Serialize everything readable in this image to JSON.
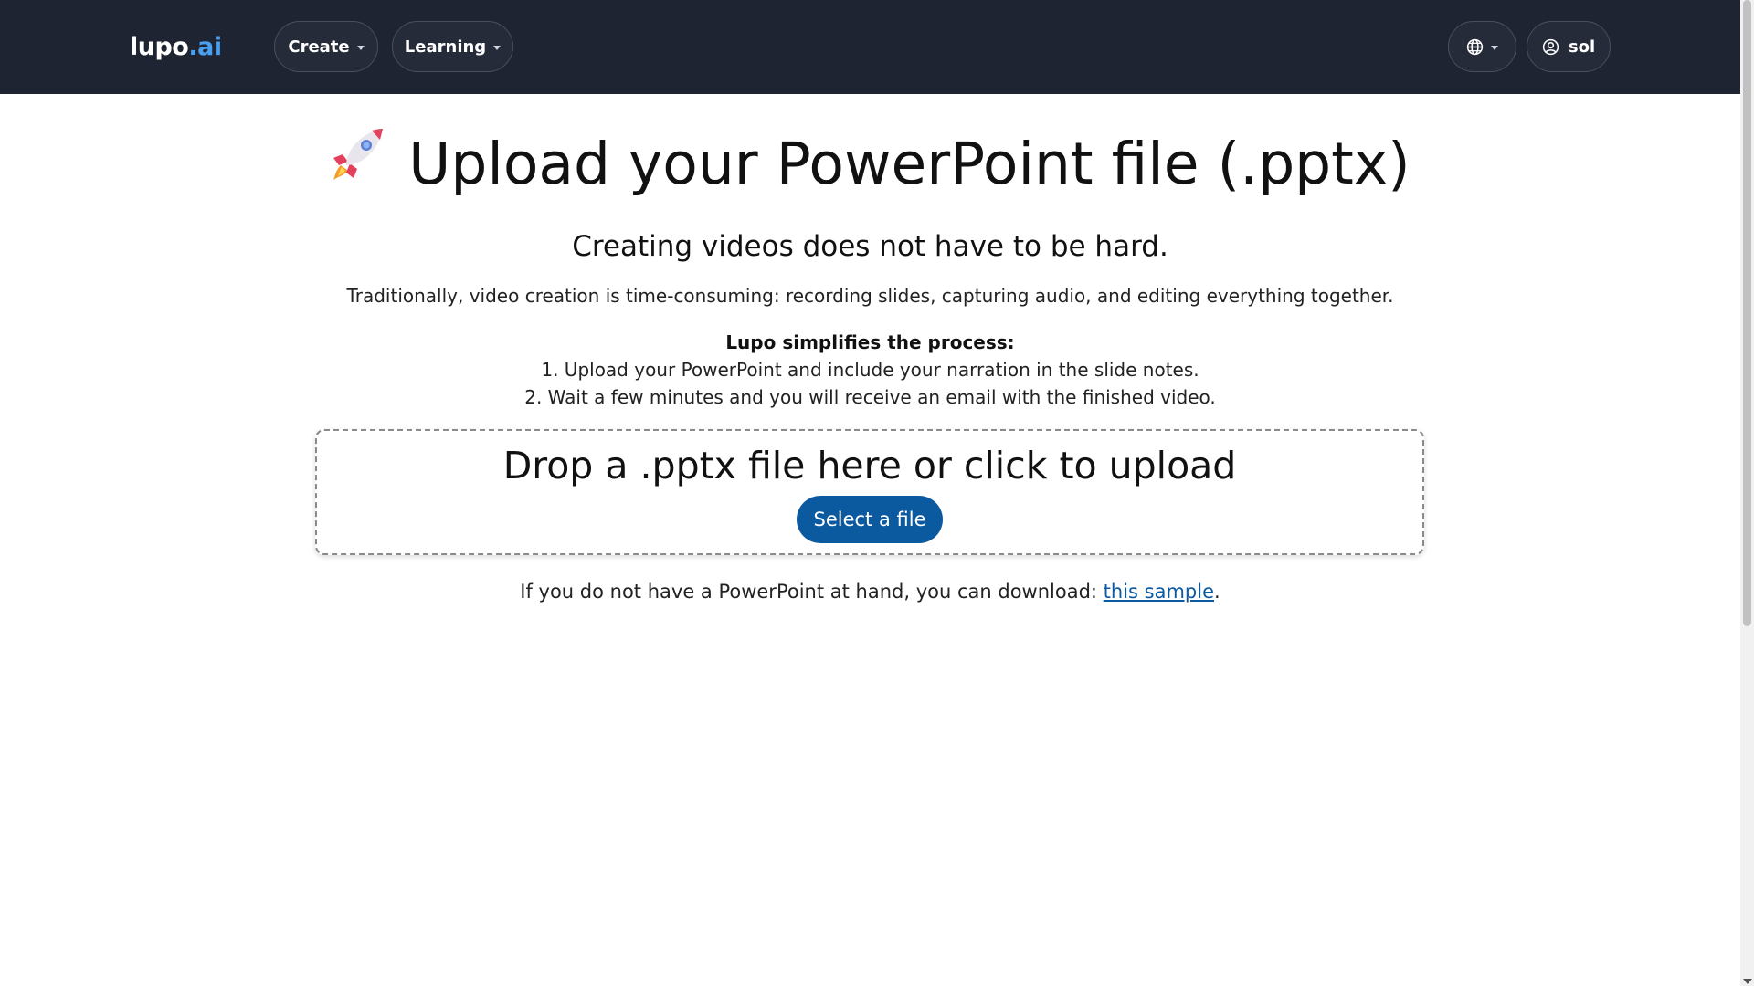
{
  "navbar": {
    "logo_main": "lupo",
    "logo_suffix": ".ai",
    "create_label": "Create",
    "learning_label": "Learning",
    "user_label": "sol",
    "language_icon": "globe-icon",
    "user_icon": "user-circle-icon"
  },
  "main": {
    "heading_icon": "rocket-icon",
    "title": "Upload your PowerPoint file (.pptx)",
    "subtitle": "Creating videos does not have to be hard.",
    "intro": "Traditionally, video creation is time-consuming: recording slides, capturing audio, and editing everything together.",
    "steps_title": "Lupo simplifies the process:",
    "steps": [
      "1. Upload your PowerPoint and include your narration in the slide notes.",
      "2. Wait a few minutes and you will receive an email with the finished video."
    ],
    "dropzone_title": "Drop a .pptx file here or click to upload",
    "select_button": "Select a file",
    "sample_prefix": "If you do not have a PowerPoint at hand, you can download: ",
    "sample_link": "this sample",
    "sample_suffix": "."
  },
  "colors": {
    "navbar_bg": "#1f2433",
    "accent": "#0b5aa0",
    "logo_accent": "#4aa0f0"
  }
}
